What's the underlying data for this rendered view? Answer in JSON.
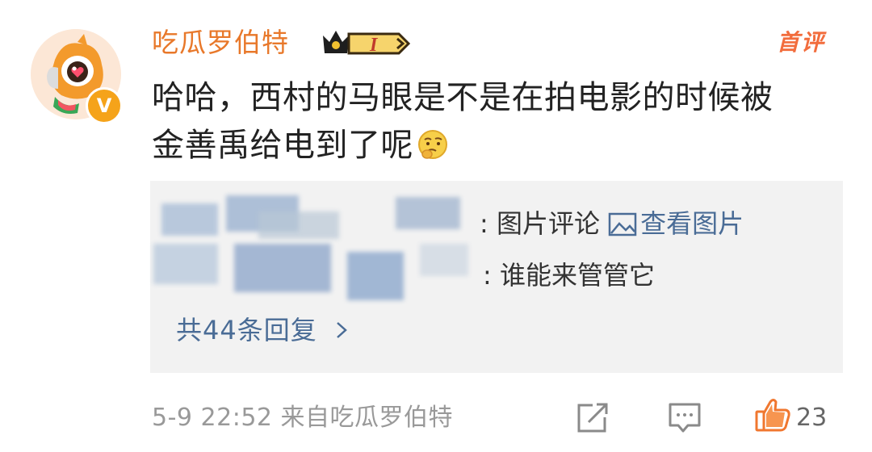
{
  "comment": {
    "username": "吃瓜罗伯特",
    "badge_level": "I",
    "first_tag": "首评",
    "verified_mark": "V",
    "text_line1": "哈哈，西村的马眼是不是在拍电影的时候被",
    "text_line2": "金善禹给电到了呢",
    "emoji": "thinking-face-emoji"
  },
  "replies": {
    "items": [
      {
        "suffix": ": 图片评论",
        "link": "查看图片",
        "link_icon": "image-icon"
      },
      {
        "suffix": ": 谁能来管管它"
      }
    ],
    "more_label": "共44条回复",
    "more_icon": "chevron-right-icon"
  },
  "footer": {
    "meta": "5-9 22:52 来自吃瓜罗伯特",
    "like_count": "23",
    "icons": [
      "share-icon",
      "comment-icon",
      "like-icon"
    ]
  },
  "colors": {
    "username": "#e8782a",
    "first_tag": "#f26d3d",
    "link": "#4a6c96",
    "like": "#f0772f",
    "reply_bg": "#f2f2f2"
  }
}
